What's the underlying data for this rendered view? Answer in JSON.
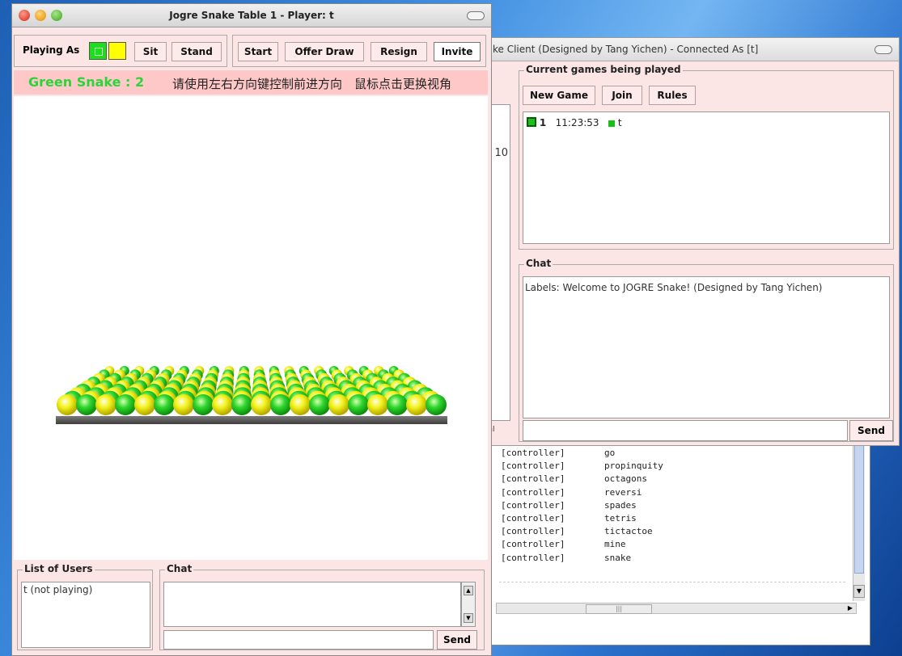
{
  "log_window": {
    "lines": [
      {
        "who": "[controller]",
        "game": "go"
      },
      {
        "who": "[controller]",
        "game": "propinquity"
      },
      {
        "who": "[controller]",
        "game": "octagons"
      },
      {
        "who": "[controller]",
        "game": "reversi"
      },
      {
        "who": "[controller]",
        "game": "spades"
      },
      {
        "who": "[controller]",
        "game": "tetris"
      },
      {
        "who": "[controller]",
        "game": "tictactoe"
      },
      {
        "who": "[controller]",
        "game": "mine"
      },
      {
        "who": "[controller]",
        "game": "snake"
      }
    ]
  },
  "client": {
    "title": "ke Client (Designed by Tang Yichen) - Connected As [t]",
    "left_strip_number": "10",
    "left_strip_fragments": [
      "ə",
      "ə",
      "ial"
    ],
    "games_panel": {
      "title": "Current games being played",
      "buttons": {
        "new_game": "New Game",
        "join": "Join",
        "rules": "Rules"
      },
      "game_row": {
        "num": "1",
        "time": "11:23:53",
        "player": "t",
        "color": "#19c019"
      }
    },
    "chat_panel": {
      "title": "Chat",
      "message": "Labels: Welcome to JOGRE Snake! (Designed by Tang Yichen)",
      "send": "Send"
    }
  },
  "table": {
    "title": "Jogre Snake Table 1 - Player: t",
    "playing_as": "Playing As",
    "buttons": {
      "sit": "Sit",
      "stand": "Stand",
      "start": "Start",
      "offer_draw": "Offer Draw",
      "resign": "Resign",
      "invite": "Invite"
    },
    "score": "Green Snake : 2",
    "instructions": "请使用左右方向键控制前进方向　鼠标点击更换视角",
    "users": {
      "title": "List of Users",
      "items": [
        "t (not playing)"
      ]
    },
    "chat": {
      "title": "Chat",
      "send": "Send"
    },
    "colors": {
      "green": "#19e019",
      "yellow": "#ffff00",
      "window": "#fbe5e5",
      "bar": "#ffc8c8"
    }
  }
}
